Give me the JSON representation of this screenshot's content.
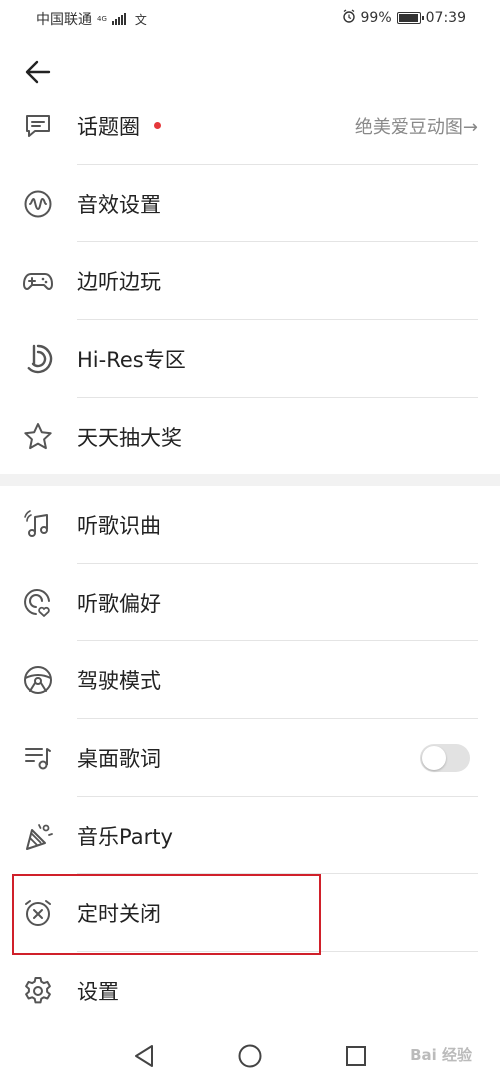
{
  "status_bar": {
    "carrier": "中国联通",
    "network": "4G",
    "extra_icon": "文",
    "battery": "99%",
    "battery_level": 0.99,
    "time": "07:39"
  },
  "menu_group_1": [
    {
      "label": "话题圈",
      "icon": "chat-icon",
      "right_text": "绝美爱豆动图→",
      "has_red_dot": true
    },
    {
      "label": "音效设置",
      "icon": "sound-wave-icon"
    },
    {
      "label": "边听边玩",
      "icon": "gamepad-icon"
    },
    {
      "label": "Hi-Res专区",
      "icon": "hires-icon"
    },
    {
      "label": "天天抽大奖",
      "icon": "star-icon"
    }
  ],
  "menu_group_2": [
    {
      "label": "听歌识曲",
      "icon": "music-recognize-icon"
    },
    {
      "label": "听歌偏好",
      "icon": "preference-icon"
    },
    {
      "label": "驾驶模式",
      "icon": "steering-wheel-icon"
    },
    {
      "label": "桌面歌词",
      "icon": "lyrics-icon",
      "toggle": false
    },
    {
      "label": "音乐Party",
      "icon": "party-hat-icon"
    },
    {
      "label": "定时关闭",
      "icon": "alarm-off-icon"
    },
    {
      "label": "设置",
      "icon": "gear-icon"
    }
  ],
  "watermark": "Bai 经验",
  "colors": {
    "accent_red": "#e5383b",
    "highlight_border": "#d0202a"
  }
}
